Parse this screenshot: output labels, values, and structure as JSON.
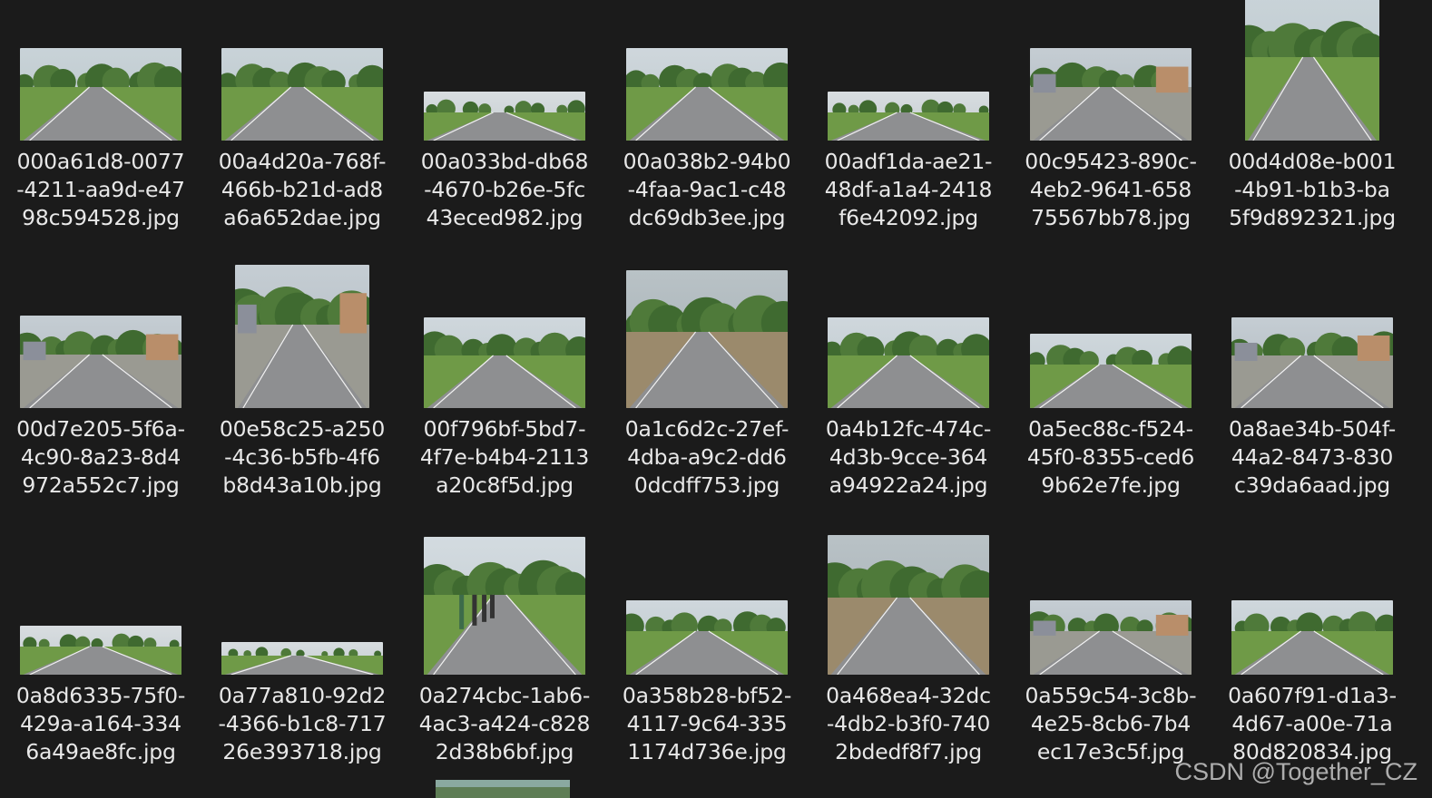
{
  "files": [
    {
      "name": [
        "000a61d8-0077",
        "-4211-aa9d-e47",
        "98c594528.jpg"
      ],
      "scene": "road-trees",
      "orientation": "landscape"
    },
    {
      "name": [
        "00a4d20a-768f-",
        "466b-b21d-ad8",
        "a6a652dae.jpg"
      ],
      "scene": "road-trees",
      "orientation": "landscape"
    },
    {
      "name": [
        "00a033bd-db68",
        "-4670-b26e-5fc",
        "43eced982.jpg"
      ],
      "scene": "road-wide",
      "orientation": "wide"
    },
    {
      "name": [
        "00a038b2-94b0",
        "-4faa-9ac1-c48",
        "dc69db3ee.jpg"
      ],
      "scene": "road-fields",
      "orientation": "landscape"
    },
    {
      "name": [
        "00adf1da-ae21-",
        "48df-a1a4-2418",
        "f6e42092.jpg"
      ],
      "scene": "road-wide",
      "orientation": "wide"
    },
    {
      "name": [
        "00c95423-890c-",
        "4eb2-9641-658",
        "75567bb78.jpg"
      ],
      "scene": "road-village",
      "orientation": "landscape"
    },
    {
      "name": [
        "00d4d08e-b001",
        "-4b91-b1b3-ba",
        "5f9d892321.jpg"
      ],
      "scene": "road-trees",
      "orientation": "portrait"
    },
    {
      "name": [
        "00d7e205-5f6a-",
        "4c90-8a23-8d4",
        "972a552c7.jpg"
      ],
      "scene": "road-village",
      "orientation": "landscape"
    },
    {
      "name": [
        "00e58c25-a250",
        "-4c36-b5fb-4f6",
        "b8d43a10b.jpg"
      ],
      "scene": "road-village",
      "orientation": "portrait"
    },
    {
      "name": [
        "00f796bf-5bd7-",
        "4f7e-b4b4-2113",
        "a20c8f5d.jpg"
      ],
      "scene": "road-fields",
      "orientation": "mid"
    },
    {
      "name": [
        "0a1c6d2c-27ef-",
        "4dba-a9c2-dd6",
        "0dcdff753.jpg"
      ],
      "scene": "road-dirt",
      "orientation": "tall"
    },
    {
      "name": [
        "0a4b12fc-474c-",
        "4d3b-9cce-364",
        "a94922a24.jpg"
      ],
      "scene": "road-fields",
      "orientation": "mid"
    },
    {
      "name": [
        "0a5ec88c-f524-",
        "45f0-8355-ced6",
        "9b62e7fe.jpg"
      ],
      "scene": "road-fields",
      "orientation": "short"
    },
    {
      "name": [
        "0a8ae34b-504f-",
        "44a2-8473-830",
        "c39da6aad.jpg"
      ],
      "scene": "road-village",
      "orientation": "mid"
    },
    {
      "name": [
        "0a8d6335-75f0-",
        "429a-a164-334",
        "6a49ae8fc.jpg"
      ],
      "scene": "road-wide",
      "orientation": "wide"
    },
    {
      "name": [
        "0a77a810-92d2",
        "-4366-b1c8-717",
        "26e393718.jpg"
      ],
      "scene": "road-wide",
      "orientation": "wide2"
    },
    {
      "name": [
        "0a274cbc-1ab6-",
        "4ac3-a424-c828",
        "2d38b6bf.jpg"
      ],
      "scene": "road-people",
      "orientation": "tall"
    },
    {
      "name": [
        "0a358b28-bf52-",
        "4117-9c64-335",
        "1174d736e.jpg"
      ],
      "scene": "road-fields",
      "orientation": "short"
    },
    {
      "name": [
        "0a468ea4-32dc",
        "-4db2-b3f0-740",
        "2bdedf8f7.jpg"
      ],
      "scene": "road-dirt",
      "orientation": "tall2"
    },
    {
      "name": [
        "0a559c54-3c8b-",
        "4e25-8cb6-7b4",
        "ec17e3c5f.jpg"
      ],
      "scene": "road-village",
      "orientation": "short"
    },
    {
      "name": [
        "0a607f91-d1a3-",
        "4d67-a00e-71a",
        "80d820834.jpg"
      ],
      "scene": "road-fields",
      "orientation": "short"
    }
  ],
  "watermark": "CSDN @Together_CZ"
}
